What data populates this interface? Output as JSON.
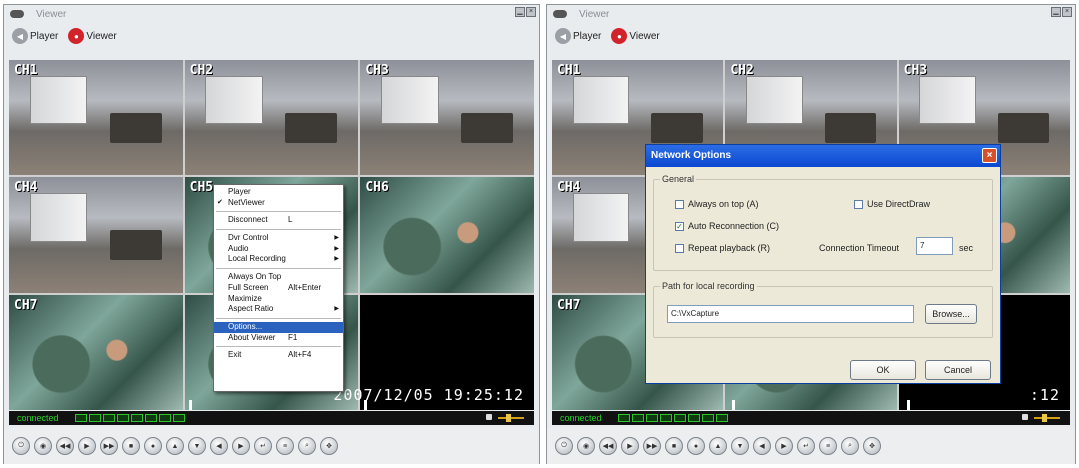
{
  "window": {
    "title": "Viewer"
  },
  "modes": {
    "player": "Player",
    "viewer": "Viewer"
  },
  "channels": [
    "CH1",
    "CH2",
    "CH3",
    "CH4",
    "CH5",
    "CH6",
    "CH7"
  ],
  "osd": {
    "datetime": "2007/12/05 19:25:12",
    "datetime_partial": ":12"
  },
  "status": {
    "connection": "connected"
  },
  "context_menu": {
    "items": [
      {
        "label": "Player"
      },
      {
        "label": "NetViewer",
        "checked": true
      },
      {
        "label": "Disconnect",
        "shortcut": "L"
      },
      {
        "label": "Dvr Control",
        "submenu": true
      },
      {
        "label": "Audio",
        "submenu": true
      },
      {
        "label": "Local Recording",
        "submenu": true
      },
      {
        "label": "Always On Top"
      },
      {
        "label": "Full Screen",
        "shortcut": "Alt+Enter"
      },
      {
        "label": "Maximize"
      },
      {
        "label": "Aspect Ratio",
        "submenu": true
      },
      {
        "label": "Options...",
        "highlighted": true
      },
      {
        "label": "About Viewer",
        "shortcut": "F1"
      },
      {
        "label": "Exit",
        "shortcut": "Alt+F4"
      }
    ]
  },
  "dialog": {
    "title": "Network Options",
    "general": "General",
    "always_on_top": "Always on top (A)",
    "use_directdraw": "Use DirectDraw",
    "auto_reconnection": "Auto Reconnection (C)",
    "repeat_playback": "Repeat playback (R)",
    "connection_timeout_label": "Connection Timeout",
    "connection_timeout_value": "7",
    "sec": "sec",
    "path_group": "Path for local recording",
    "path_value": "C:\\VxCapture",
    "browse": "Browse...",
    "ok": "OK",
    "cancel": "Cancel",
    "checked": {
      "always_on_top": false,
      "use_directdraw": false,
      "auto_reconnection": true,
      "repeat_playback": false
    }
  },
  "colors": {
    "highlight": "#2a62bd",
    "status_green": "#28d228",
    "viewer_mode": "#d2232a",
    "dialog_title": "#0a48d1"
  }
}
